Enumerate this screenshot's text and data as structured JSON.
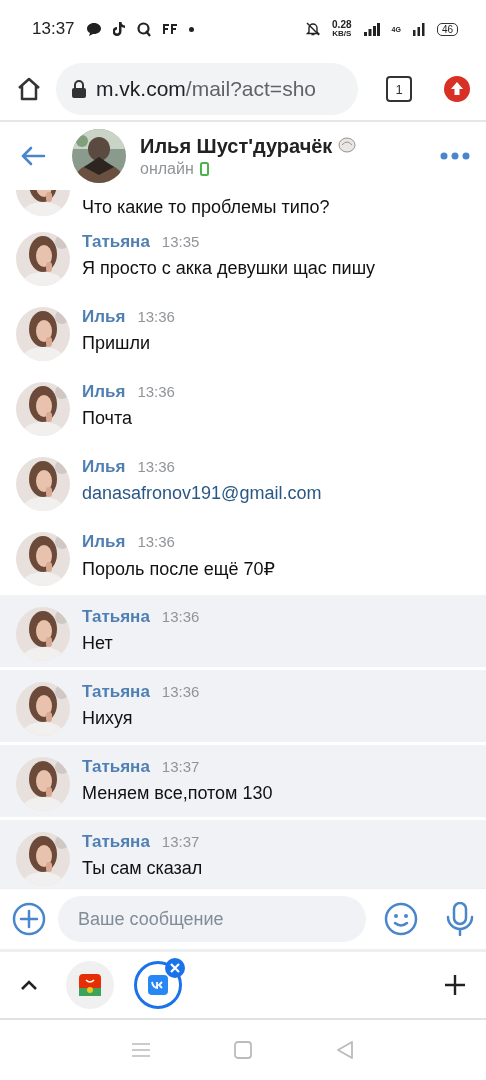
{
  "status_bar": {
    "time": "13:37",
    "speed": "0.28",
    "speed_unit": "KB/S",
    "network": "4G",
    "battery": "46"
  },
  "browser": {
    "url_host": "m.vk.com",
    "url_path": "/mail?act=sho",
    "tab_count": "1"
  },
  "chat_header": {
    "name": "Илья Шуст'дурачёк",
    "status": "онлайн"
  },
  "messages": [
    {
      "kind": "continuation",
      "text": "Что какие то проблемы типо?",
      "highlighted": false
    },
    {
      "kind": "message",
      "author": "Татьяна",
      "time": "13:35",
      "text": "Я просто с акка девушки щас пишу",
      "highlighted": false
    },
    {
      "kind": "message",
      "author": "Илья",
      "time": "13:36",
      "text": "Пришли",
      "highlighted": false
    },
    {
      "kind": "message",
      "author": "Илья",
      "time": "13:36",
      "text": "Почта",
      "highlighted": false
    },
    {
      "kind": "link",
      "author": "Илья",
      "time": "13:36",
      "text": "danasafronov191@gmail.com",
      "highlighted": false
    },
    {
      "kind": "message",
      "author": "Илья",
      "time": "13:36",
      "text": "Пороль после ещё 70₽",
      "highlighted": false
    },
    {
      "kind": "message",
      "author": "Татьяна",
      "time": "13:36",
      "text": "Нет",
      "highlighted": true
    },
    {
      "kind": "message",
      "author": "Татьяна",
      "time": "13:36",
      "text": "Нихуя",
      "highlighted": true
    },
    {
      "kind": "message",
      "author": "Татьяна",
      "time": "13:37",
      "text": "Меняем все,потом 130",
      "highlighted": true
    },
    {
      "kind": "message",
      "author": "Татьяна",
      "time": "13:37",
      "text": "Ты сам сказал",
      "highlighted": true
    }
  ],
  "composer": {
    "placeholder": "Ваше сообщение"
  },
  "tab_strip": {
    "tabs": [
      {
        "kind": "shop",
        "selected": false
      },
      {
        "kind": "vk",
        "selected": true
      }
    ]
  }
}
